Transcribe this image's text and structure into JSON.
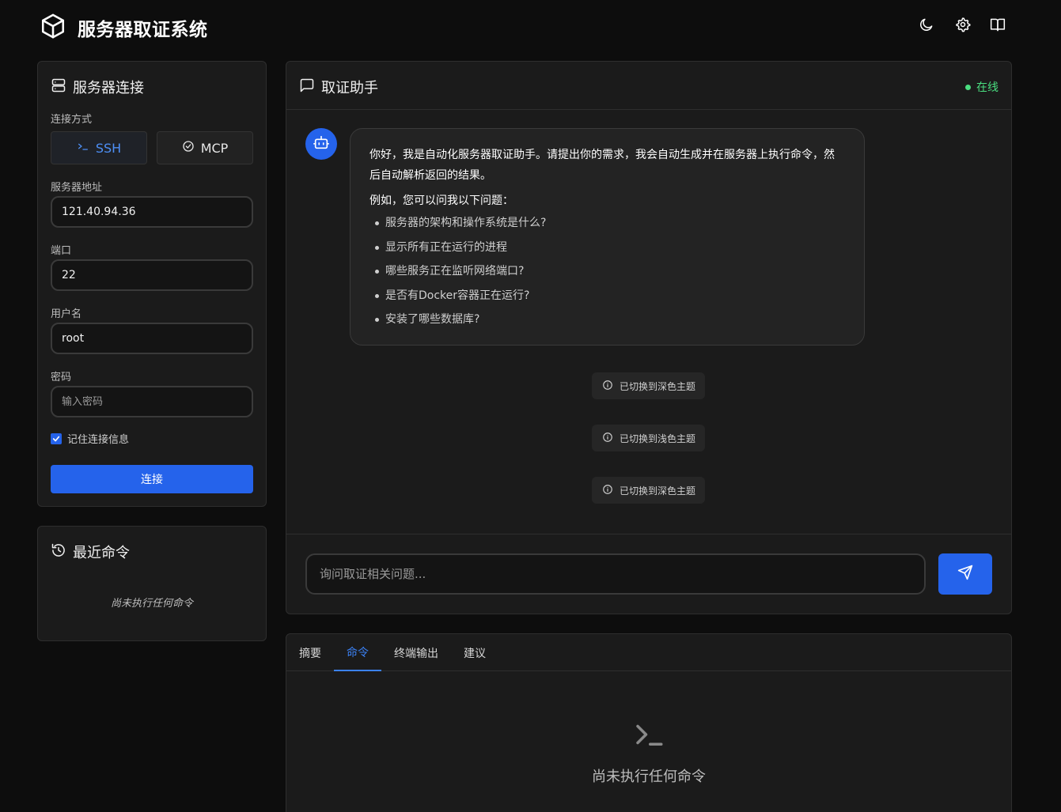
{
  "header": {
    "title": "服务器取证系统",
    "icons": [
      "cube-logo-icon",
      "moon-icon",
      "gear-icon",
      "book-icon"
    ]
  },
  "connection": {
    "title": "服务器连接",
    "method_label": "连接方式",
    "methods": [
      {
        "label": "SSH",
        "icon": "terminal-icon",
        "active": true
      },
      {
        "label": "MCP",
        "icon": "check-circle-icon",
        "active": false
      }
    ],
    "host_label": "服务器地址",
    "host_value": "121.40.94.36",
    "port_label": "端口",
    "port_value": "22",
    "user_label": "用户名",
    "user_value": "root",
    "password_label": "密码",
    "password_placeholder": "输入密码",
    "remember_label": "记住连接信息",
    "remember_checked": true,
    "connect_label": "连接"
  },
  "recent": {
    "title": "最近命令",
    "empty_text": "尚未执行任何命令"
  },
  "chat": {
    "title": "取证助手",
    "status": "在线",
    "status_color": "#4ade80",
    "greeting": "你好，我是自动化服务器取证助手。请提出你的需求，我会自动生成并在服务器上执行命令，然后自动解析返回的结果。",
    "examples_intro": "例如，您可以问我以下问题：",
    "examples": [
      "服务器的架构和操作系统是什么?",
      "显示所有正在运行的进程",
      "哪些服务正在监听网络端口?",
      "是否有Docker容器正在运行?",
      "安装了哪些数据库?"
    ],
    "system_notes": [
      "已切换到深色主题",
      "已切换到浅色主题",
      "已切换到深色主题"
    ],
    "input_placeholder": "询问取证相关问题..."
  },
  "results": {
    "tabs": [
      {
        "label": "摘要",
        "active": false
      },
      {
        "label": "命令",
        "active": true
      },
      {
        "label": "终端输出",
        "active": false
      },
      {
        "label": "建议",
        "active": false
      }
    ],
    "empty_text": "尚未执行任何命令"
  },
  "colors": {
    "accent": "#2563eb",
    "background": "#0d0d0d",
    "card": "#1b1b1b"
  }
}
